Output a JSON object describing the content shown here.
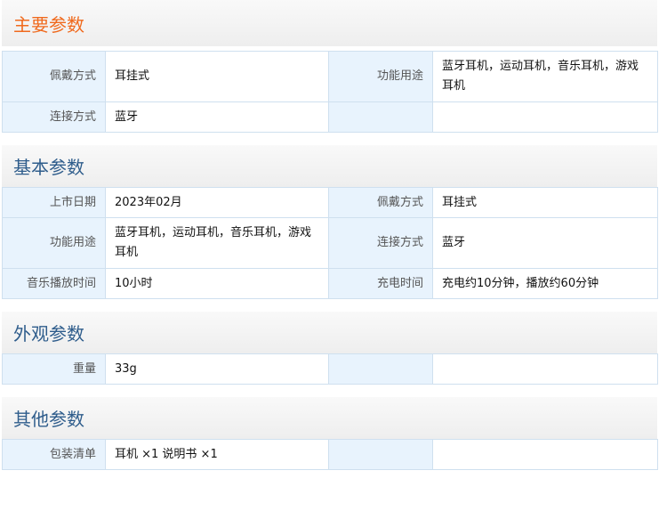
{
  "sections": [
    {
      "title": "主要参数",
      "rows": [
        [
          {
            "k": "佩戴方式",
            "v": "耳挂式"
          },
          {
            "k": "功能用途",
            "v": "蓝牙耳机，运动耳机，音乐耳机，游戏耳机"
          }
        ],
        [
          {
            "k": "连接方式",
            "v": "蓝牙"
          },
          {
            "k": "",
            "v": ""
          }
        ]
      ]
    },
    {
      "title": "基本参数",
      "rows": [
        [
          {
            "k": "上市日期",
            "v": "2023年02月"
          },
          {
            "k": "佩戴方式",
            "v": "耳挂式"
          }
        ],
        [
          {
            "k": "功能用途",
            "v": "蓝牙耳机，运动耳机，音乐耳机，游戏耳机"
          },
          {
            "k": "连接方式",
            "v": "蓝牙"
          }
        ],
        [
          {
            "k": "音乐播放时间",
            "v": "10小时"
          },
          {
            "k": "充电时间",
            "v": "充电约10分钟，播放约60分钟"
          }
        ]
      ]
    },
    {
      "title": "外观参数",
      "rows": [
        [
          {
            "k": "重量",
            "v": "33g"
          },
          {
            "k": "",
            "v": ""
          }
        ]
      ]
    },
    {
      "title": "其他参数",
      "rows": [
        [
          {
            "k": "包装清单",
            "v": "耳机 ×1 说明书 ×1"
          },
          {
            "k": "",
            "v": ""
          }
        ]
      ]
    }
  ],
  "colors": {
    "accent_orange": "#f06a1e",
    "title_blue": "#2f5d8c",
    "key_bg": "#e8f3fd",
    "border": "#cfe0ef"
  }
}
